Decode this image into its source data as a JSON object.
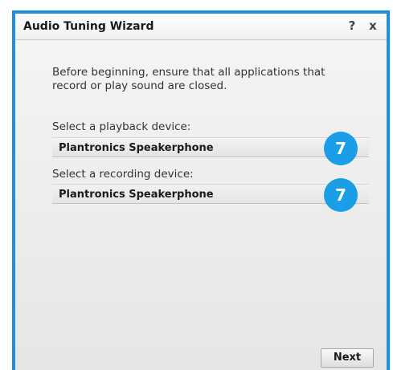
{
  "window": {
    "title": "Audio Tuning Wizard",
    "help_label": "?",
    "close_label": "x",
    "accent_color": "#1e90e0"
  },
  "content": {
    "intro": "Before beginning, ensure that all applications that record or play sound are closed.",
    "playback": {
      "label": "Select a playback device:",
      "value": "Plantronics Speakerphone",
      "callout": "7"
    },
    "recording": {
      "label": "Select a recording device:",
      "value": "Plantronics Speakerphone",
      "callout": "7"
    }
  },
  "footer": {
    "next_label": "Next"
  },
  "callout_color": "#1a9ee8"
}
